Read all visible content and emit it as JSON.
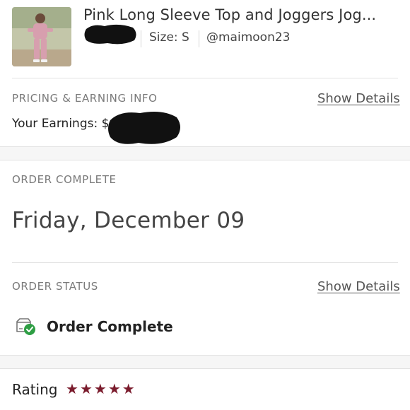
{
  "item": {
    "title": "Pink Long Sleeve Top and Joggers Jog...",
    "size": "Size: S",
    "seller": "@maimoon23",
    "thumbnail_icon": "product-photo"
  },
  "pricing": {
    "label": "PRICING & EARNING INFO",
    "show_details": "Show Details",
    "earnings_label": "Your Earnings: $"
  },
  "order_complete": {
    "label": "ORDER COMPLETE",
    "date": "Friday, December 09"
  },
  "order_status": {
    "label": "ORDER STATUS",
    "show_details": "Show Details",
    "status": "Order Complete",
    "icon": "package-check-icon"
  },
  "rating": {
    "label": "Rating",
    "stars": 5,
    "max_stars": 5,
    "star_color": "#7a1b2c"
  },
  "colors": {
    "check_green": "#2e9e44",
    "star": "#7a1b2c"
  }
}
